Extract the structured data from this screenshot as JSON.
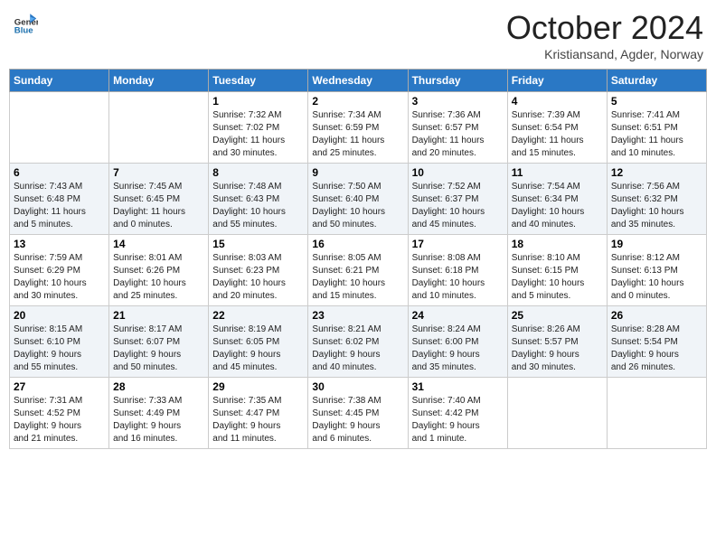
{
  "logo": {
    "line1": "General",
    "line2": "Blue",
    "icon": "▶"
  },
  "title": "October 2024",
  "location": "Kristiansand, Agder, Norway",
  "weekdays": [
    "Sunday",
    "Monday",
    "Tuesday",
    "Wednesday",
    "Thursday",
    "Friday",
    "Saturday"
  ],
  "weeks": [
    [
      {
        "day": "",
        "info": ""
      },
      {
        "day": "",
        "info": ""
      },
      {
        "day": "1",
        "info": "Sunrise: 7:32 AM\nSunset: 7:02 PM\nDaylight: 11 hours\nand 30 minutes."
      },
      {
        "day": "2",
        "info": "Sunrise: 7:34 AM\nSunset: 6:59 PM\nDaylight: 11 hours\nand 25 minutes."
      },
      {
        "day": "3",
        "info": "Sunrise: 7:36 AM\nSunset: 6:57 PM\nDaylight: 11 hours\nand 20 minutes."
      },
      {
        "day": "4",
        "info": "Sunrise: 7:39 AM\nSunset: 6:54 PM\nDaylight: 11 hours\nand 15 minutes."
      },
      {
        "day": "5",
        "info": "Sunrise: 7:41 AM\nSunset: 6:51 PM\nDaylight: 11 hours\nand 10 minutes."
      }
    ],
    [
      {
        "day": "6",
        "info": "Sunrise: 7:43 AM\nSunset: 6:48 PM\nDaylight: 11 hours\nand 5 minutes."
      },
      {
        "day": "7",
        "info": "Sunrise: 7:45 AM\nSunset: 6:45 PM\nDaylight: 11 hours\nand 0 minutes."
      },
      {
        "day": "8",
        "info": "Sunrise: 7:48 AM\nSunset: 6:43 PM\nDaylight: 10 hours\nand 55 minutes."
      },
      {
        "day": "9",
        "info": "Sunrise: 7:50 AM\nSunset: 6:40 PM\nDaylight: 10 hours\nand 50 minutes."
      },
      {
        "day": "10",
        "info": "Sunrise: 7:52 AM\nSunset: 6:37 PM\nDaylight: 10 hours\nand 45 minutes."
      },
      {
        "day": "11",
        "info": "Sunrise: 7:54 AM\nSunset: 6:34 PM\nDaylight: 10 hours\nand 40 minutes."
      },
      {
        "day": "12",
        "info": "Sunrise: 7:56 AM\nSunset: 6:32 PM\nDaylight: 10 hours\nand 35 minutes."
      }
    ],
    [
      {
        "day": "13",
        "info": "Sunrise: 7:59 AM\nSunset: 6:29 PM\nDaylight: 10 hours\nand 30 minutes."
      },
      {
        "day": "14",
        "info": "Sunrise: 8:01 AM\nSunset: 6:26 PM\nDaylight: 10 hours\nand 25 minutes."
      },
      {
        "day": "15",
        "info": "Sunrise: 8:03 AM\nSunset: 6:23 PM\nDaylight: 10 hours\nand 20 minutes."
      },
      {
        "day": "16",
        "info": "Sunrise: 8:05 AM\nSunset: 6:21 PM\nDaylight: 10 hours\nand 15 minutes."
      },
      {
        "day": "17",
        "info": "Sunrise: 8:08 AM\nSunset: 6:18 PM\nDaylight: 10 hours\nand 10 minutes."
      },
      {
        "day": "18",
        "info": "Sunrise: 8:10 AM\nSunset: 6:15 PM\nDaylight: 10 hours\nand 5 minutes."
      },
      {
        "day": "19",
        "info": "Sunrise: 8:12 AM\nSunset: 6:13 PM\nDaylight: 10 hours\nand 0 minutes."
      }
    ],
    [
      {
        "day": "20",
        "info": "Sunrise: 8:15 AM\nSunset: 6:10 PM\nDaylight: 9 hours\nand 55 minutes."
      },
      {
        "day": "21",
        "info": "Sunrise: 8:17 AM\nSunset: 6:07 PM\nDaylight: 9 hours\nand 50 minutes."
      },
      {
        "day": "22",
        "info": "Sunrise: 8:19 AM\nSunset: 6:05 PM\nDaylight: 9 hours\nand 45 minutes."
      },
      {
        "day": "23",
        "info": "Sunrise: 8:21 AM\nSunset: 6:02 PM\nDaylight: 9 hours\nand 40 minutes."
      },
      {
        "day": "24",
        "info": "Sunrise: 8:24 AM\nSunset: 6:00 PM\nDaylight: 9 hours\nand 35 minutes."
      },
      {
        "day": "25",
        "info": "Sunrise: 8:26 AM\nSunset: 5:57 PM\nDaylight: 9 hours\nand 30 minutes."
      },
      {
        "day": "26",
        "info": "Sunrise: 8:28 AM\nSunset: 5:54 PM\nDaylight: 9 hours\nand 26 minutes."
      }
    ],
    [
      {
        "day": "27",
        "info": "Sunrise: 7:31 AM\nSunset: 4:52 PM\nDaylight: 9 hours\nand 21 minutes."
      },
      {
        "day": "28",
        "info": "Sunrise: 7:33 AM\nSunset: 4:49 PM\nDaylight: 9 hours\nand 16 minutes."
      },
      {
        "day": "29",
        "info": "Sunrise: 7:35 AM\nSunset: 4:47 PM\nDaylight: 9 hours\nand 11 minutes."
      },
      {
        "day": "30",
        "info": "Sunrise: 7:38 AM\nSunset: 4:45 PM\nDaylight: 9 hours\nand 6 minutes."
      },
      {
        "day": "31",
        "info": "Sunrise: 7:40 AM\nSunset: 4:42 PM\nDaylight: 9 hours\nand 1 minute."
      },
      {
        "day": "",
        "info": ""
      },
      {
        "day": "",
        "info": ""
      }
    ]
  ]
}
